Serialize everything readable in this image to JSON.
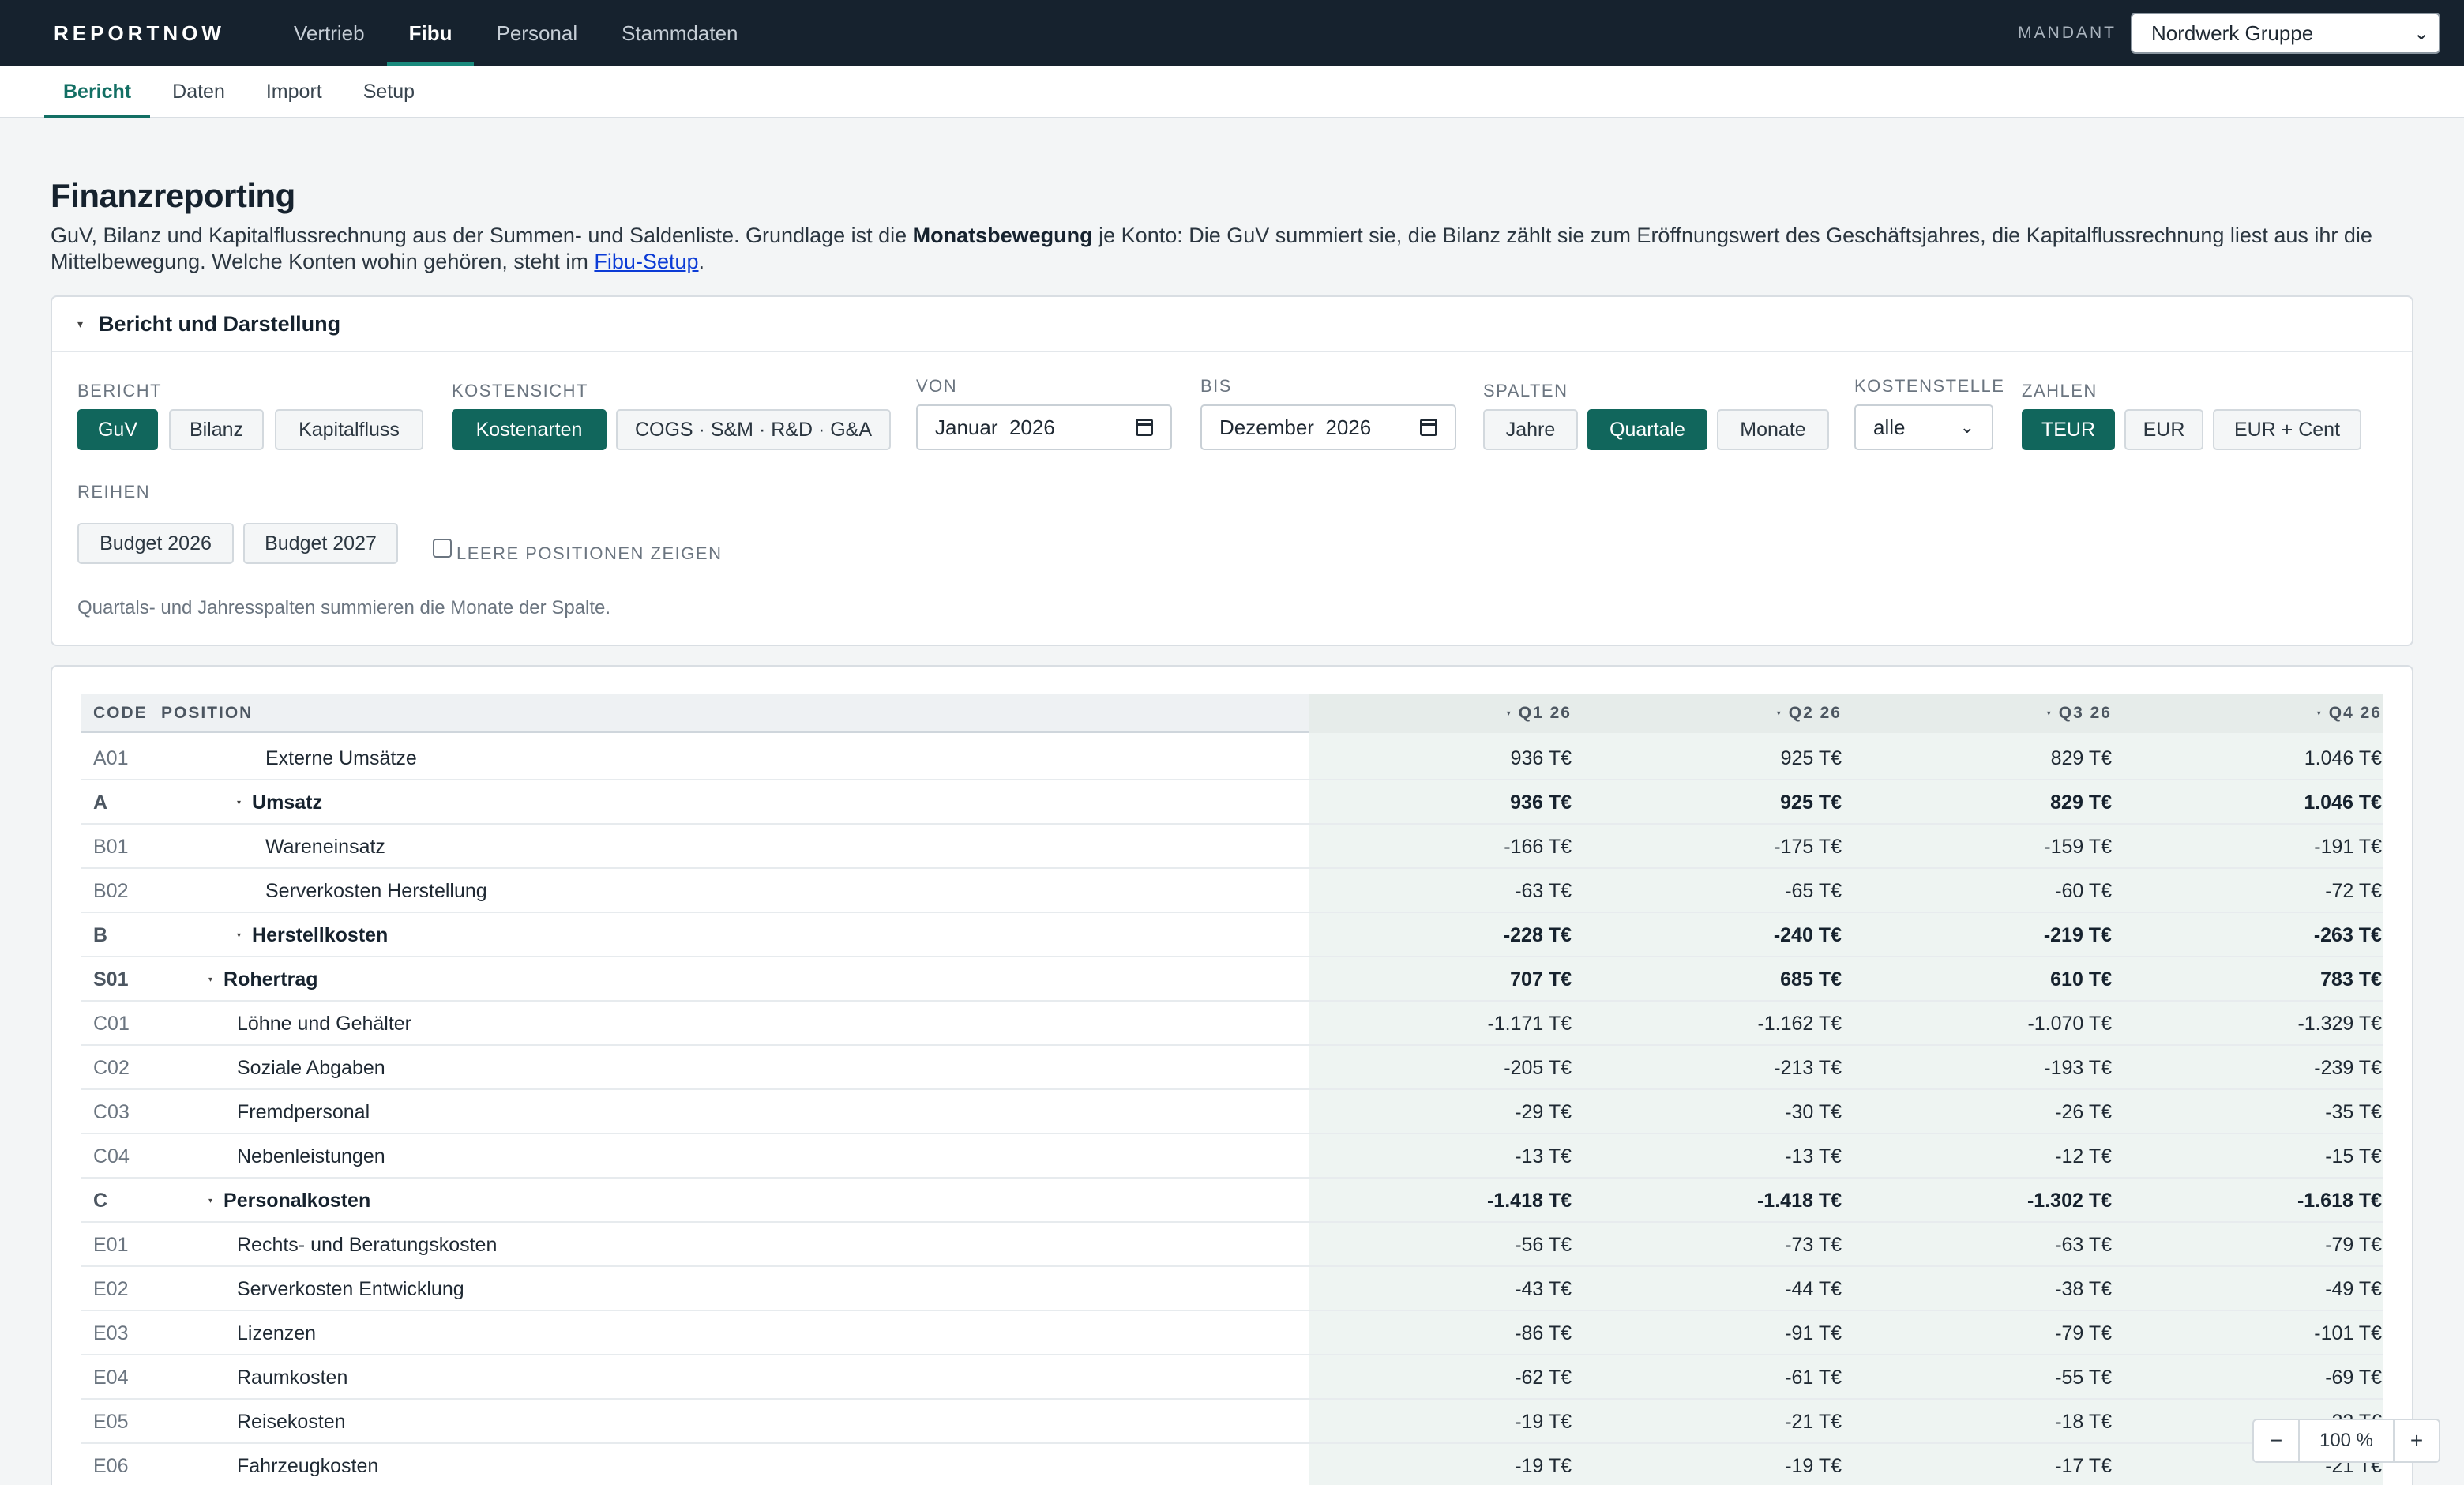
{
  "topbar": {
    "brand": "REPORTNOW",
    "nav": [
      "Vertrieb",
      "Fibu",
      "Personal",
      "Stammdaten"
    ],
    "mandant_label": "MANDANT",
    "mandant_value": "Nordwerk Gruppe"
  },
  "subnav": [
    "Bericht",
    "Daten",
    "Import",
    "Setup"
  ],
  "page": {
    "title": "Finanzreporting",
    "intro_a": "GuV, Bilanz und Kapitalflussrechnung aus der Summen- und Saldenliste. Grundlage ist die ",
    "intro_bold": "Monatsbewegung",
    "intro_b": " je Konto: Die GuV summiert sie, die Bilanz zählt sie zum Eröffnungswert des Geschäftsjahres, die Kapitalflussrechnung liest aus ihr die Mittelbewegung. Welche Konten wohin gehören, steht im ",
    "intro_link": "Fibu-Setup",
    "intro_end": "."
  },
  "panel": {
    "title": "Bericht und Darstellung",
    "bericht_label": "BERICHT",
    "bericht": [
      "GuV",
      "Bilanz",
      "Kapitalfluss"
    ],
    "kostensicht_label": "KOSTENSICHT",
    "kostensicht": [
      "Kostenarten",
      "COGS · S&M · R&D · G&A"
    ],
    "von_label": "VON",
    "von_value": "Januar  2026",
    "bis_label": "BIS",
    "bis_value": "Dezember  2026",
    "spalten_label": "SPALTEN",
    "spalten": [
      "Jahre",
      "Quartale",
      "Monate"
    ],
    "kostenstelle_label": "KOSTENSTELLE",
    "kostenstelle_value": "alle",
    "zahlen_label": "ZAHLEN",
    "zahlen": [
      "TEUR",
      "EUR",
      "EUR + Cent"
    ],
    "reihen_label": "REIHEN",
    "reihen": [
      "Budget 2026",
      "Budget 2027"
    ],
    "leere_label": "LEERE POSITIONEN ZEIGEN",
    "note": "Quartals- und Jahresspalten summieren die Monate der Spalte."
  },
  "table": {
    "headers": [
      "CODE",
      "POSITION",
      "Q1 26",
      "Q2 26",
      "Q3 26",
      "Q4 26"
    ],
    "rows": [
      {
        "code": "A01",
        "position": "Externe Umsätze",
        "values": [
          "936 T€",
          "925 T€",
          "829 T€",
          "1.046 T€"
        ]
      },
      {
        "code": "A",
        "position": "Umsatz",
        "values": [
          "936 T€",
          "925 T€",
          "829 T€",
          "1.046 T€"
        ]
      },
      {
        "code": "B01",
        "position": "Wareneinsatz",
        "values": [
          "-166 T€",
          "-175 T€",
          "-159 T€",
          "-191 T€"
        ]
      },
      {
        "code": "B02",
        "position": "Serverkosten Herstellung",
        "values": [
          "-63 T€",
          "-65 T€",
          "-60 T€",
          "-72 T€"
        ]
      },
      {
        "code": "B",
        "position": "Herstellkosten",
        "values": [
          "-228 T€",
          "-240 T€",
          "-219 T€",
          "-263 T€"
        ]
      },
      {
        "code": "S01",
        "position": "Rohertrag",
        "values": [
          "707 T€",
          "685 T€",
          "610 T€",
          "783 T€"
        ]
      },
      {
        "code": "C01",
        "position": "Löhne und Gehälter",
        "values": [
          "-1.171 T€",
          "-1.162 T€",
          "-1.070 T€",
          "-1.329 T€"
        ]
      },
      {
        "code": "C02",
        "position": "Soziale Abgaben",
        "values": [
          "-205 T€",
          "-213 T€",
          "-193 T€",
          "-239 T€"
        ]
      },
      {
        "code": "C03",
        "position": "Fremdpersonal",
        "values": [
          "-29 T€",
          "-30 T€",
          "-26 T€",
          "-35 T€"
        ]
      },
      {
        "code": "C04",
        "position": "Nebenleistungen",
        "values": [
          "-13 T€",
          "-13 T€",
          "-12 T€",
          "-15 T€"
        ]
      },
      {
        "code": "C",
        "position": "Personalkosten",
        "values": [
          "-1.418 T€",
          "-1.418 T€",
          "-1.302 T€",
          "-1.618 T€"
        ]
      },
      {
        "code": "E01",
        "position": "Rechts- und Beratungskosten",
        "values": [
          "-56 T€",
          "-73 T€",
          "-63 T€",
          "-79 T€"
        ]
      },
      {
        "code": "E02",
        "position": "Serverkosten Entwicklung",
        "values": [
          "-43 T€",
          "-44 T€",
          "-38 T€",
          "-49 T€"
        ]
      },
      {
        "code": "E03",
        "position": "Lizenzen",
        "values": [
          "-86 T€",
          "-91 T€",
          "-79 T€",
          "-101 T€"
        ]
      },
      {
        "code": "E04",
        "position": "Raumkosten",
        "values": [
          "-62 T€",
          "-61 T€",
          "-55 T€",
          "-69 T€"
        ]
      },
      {
        "code": "E05",
        "position": "Reisekosten",
        "values": [
          "-19 T€",
          "-21 T€",
          "-18 T€",
          "-23 T€"
        ]
      },
      {
        "code": "E06",
        "position": "Fahrzeugkosten",
        "values": [
          "-19 T€",
          "-19 T€",
          "-17 T€",
          "-21 T€"
        ]
      }
    ]
  },
  "zoom": {
    "minus": "−",
    "value": "100 %",
    "plus": "+"
  },
  "colors": {
    "accent": "#11665c",
    "topbar": "#16222e",
    "highlight_column": "#eef4f2"
  }
}
